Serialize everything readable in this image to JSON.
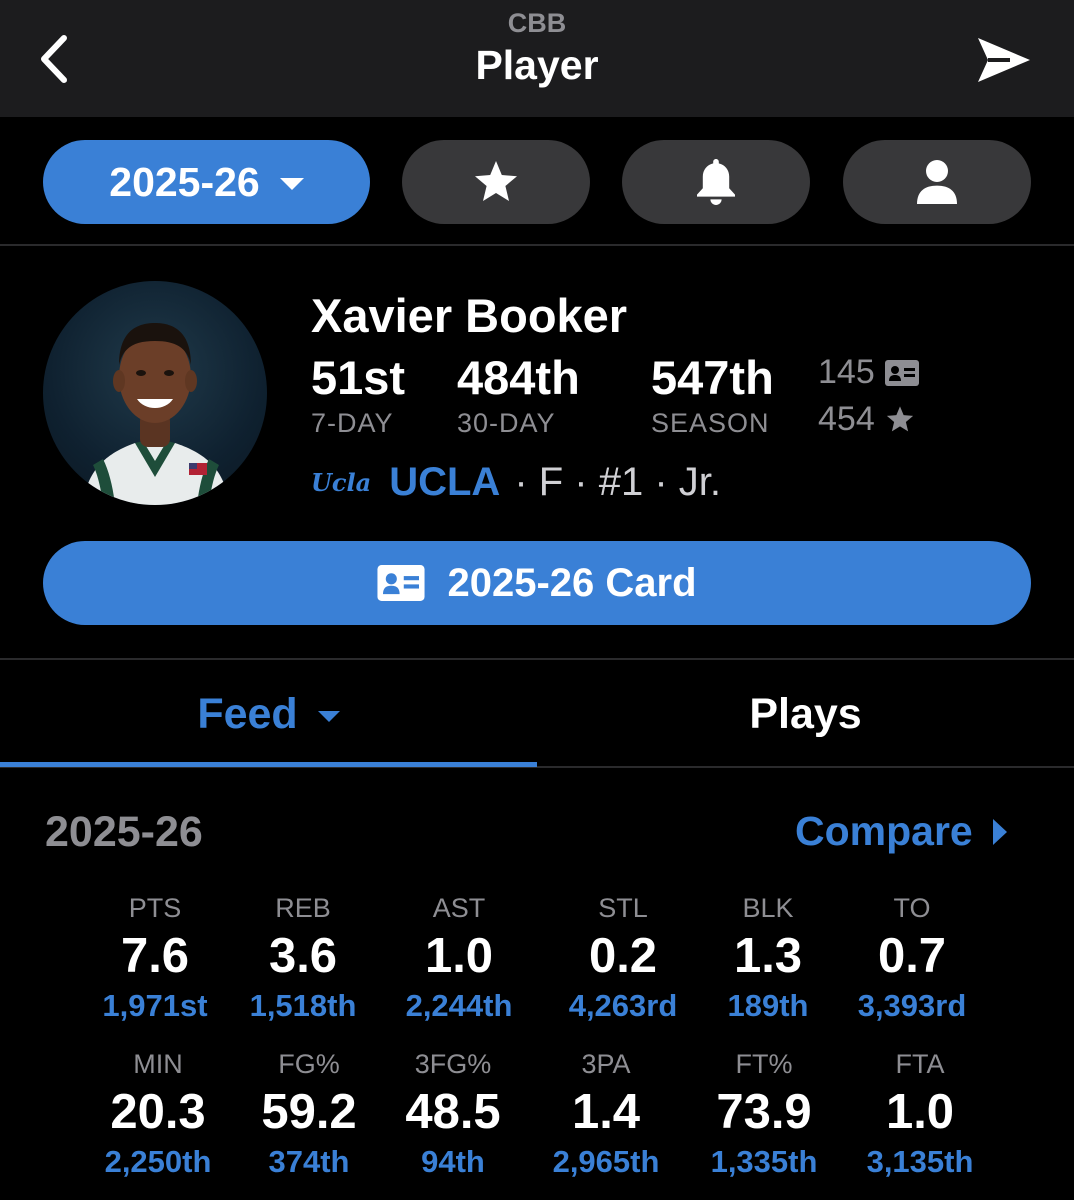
{
  "header": {
    "league": "CBB",
    "title": "Player"
  },
  "toolbar": {
    "season": "2025-26",
    "icons": [
      "star-icon",
      "bell-icon",
      "person-icon"
    ]
  },
  "player": {
    "name": "Xavier Booker",
    "ranks": [
      {
        "value": "51st",
        "label": "7-DAY"
      },
      {
        "value": "484th",
        "label": "30-DAY"
      },
      {
        "value": "547th",
        "label": "SEASON"
      }
    ],
    "cards_count": "145",
    "stars_count": "454",
    "team_logo_text": "Ucla",
    "team": "UCLA",
    "meta": "· F · #1 · Jr."
  },
  "card_button": {
    "label": "2025-26 Card"
  },
  "tabs": {
    "feed": "Feed",
    "plays": "Plays",
    "active": "Feed"
  },
  "stats": {
    "season": "2025-26",
    "compare_label": "Compare",
    "row1": [
      {
        "label": "PTS",
        "value": "7.6",
        "rank": "1,971st"
      },
      {
        "label": "REB",
        "value": "3.6",
        "rank": "1,518th"
      },
      {
        "label": "AST",
        "value": "1.0",
        "rank": "2,244th"
      },
      {
        "label": "STL",
        "value": "0.2",
        "rank": "4,263rd"
      },
      {
        "label": "BLK",
        "value": "1.3",
        "rank": "189th"
      },
      {
        "label": "TO",
        "value": "0.7",
        "rank": "3,393rd"
      }
    ],
    "row2": [
      {
        "label": "MIN",
        "value": "20.3",
        "rank": "2,250th"
      },
      {
        "label": "FG%",
        "value": "59.2",
        "rank": "374th"
      },
      {
        "label": "3FG%",
        "value": "48.5",
        "rank": "94th"
      },
      {
        "label": "3PA",
        "value": "1.4",
        "rank": "2,965th"
      },
      {
        "label": "FT%",
        "value": "73.9",
        "rank": "1,335th"
      },
      {
        "label": "FTA",
        "value": "1.0",
        "rank": "3,135th"
      }
    ]
  },
  "colors": {
    "accent": "#3a80d6",
    "background": "#000000",
    "header": "#1c1c1e",
    "pill": "#38383a",
    "muted": "#8e8e93"
  }
}
